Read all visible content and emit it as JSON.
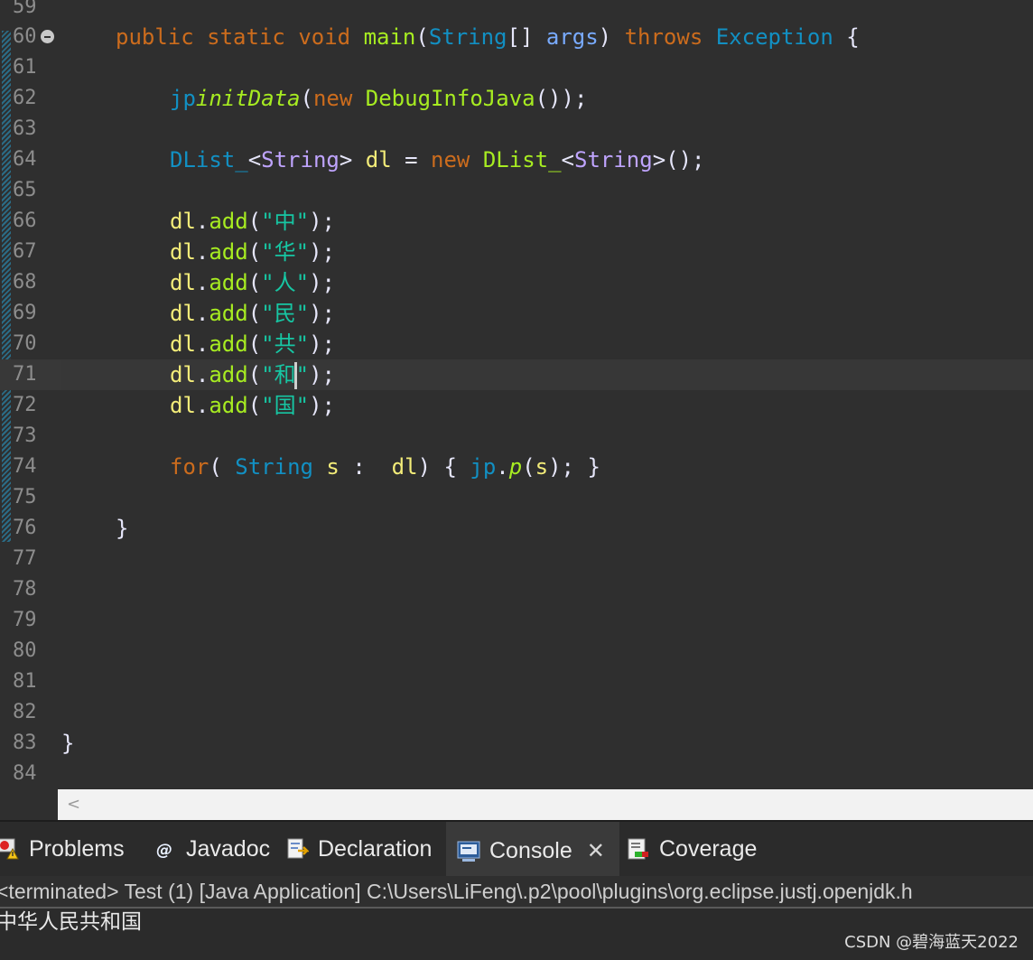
{
  "editor": {
    "lines": [
      {
        "n": "59"
      },
      {
        "n": "60"
      },
      {
        "n": "61"
      },
      {
        "n": "62"
      },
      {
        "n": "63"
      },
      {
        "n": "64"
      },
      {
        "n": "65"
      },
      {
        "n": "66"
      },
      {
        "n": "67"
      },
      {
        "n": "68"
      },
      {
        "n": "69"
      },
      {
        "n": "70"
      },
      {
        "n": "71"
      },
      {
        "n": "72"
      },
      {
        "n": "73"
      },
      {
        "n": "74"
      },
      {
        "n": "75"
      },
      {
        "n": "76"
      },
      {
        "n": "77"
      },
      {
        "n": "78"
      },
      {
        "n": "79"
      },
      {
        "n": "80"
      },
      {
        "n": "81"
      },
      {
        "n": "82"
      },
      {
        "n": "83"
      },
      {
        "n": "84"
      }
    ],
    "code": {
      "l60": {
        "public": "public",
        "static": "static",
        "void": "void",
        "main": "main",
        "p1": "(",
        "String": "String",
        "arr": "[] ",
        "args": "args",
        "p2": ") ",
        "throws": "throws",
        "Exception": "Exception",
        "p3": " {"
      },
      "l62": {
        "jp": "jp",
        ".": ".",
        "initData": "initData",
        "p1": "(",
        "new": "new",
        "DebugInfoJava": "DebugInfoJava",
        "p2": "());"
      },
      "l64": {
        "DList": "DList_",
        "lt": "<",
        "String": "String",
        "gt": "> ",
        "dl": "dl",
        "eq": " = ",
        "new": "new",
        "DList2": "DList_",
        "lt2": "<",
        "String2": "String",
        "gt2": ">",
        "end": "();"
      },
      "adds": [
        {
          "obj": "dl",
          "dot": ".",
          "method": "add",
          "open": "(",
          "str": "\"中\"",
          "close": ");"
        },
        {
          "obj": "dl",
          "dot": ".",
          "method": "add",
          "open": "(",
          "str": "\"华\"",
          "close": ");"
        },
        {
          "obj": "dl",
          "dot": ".",
          "method": "add",
          "open": "(",
          "str": "\"人\"",
          "close": ");"
        },
        {
          "obj": "dl",
          "dot": ".",
          "method": "add",
          "open": "(",
          "str": "\"民\"",
          "close": ");"
        },
        {
          "obj": "dl",
          "dot": ".",
          "method": "add",
          "open": "(",
          "str": "\"共\"",
          "close": ");"
        },
        {
          "obj": "dl",
          "dot": ".",
          "method": "add",
          "open": "(",
          "str_a": "\"和",
          "str_b": "\"",
          "close": ");"
        },
        {
          "obj": "dl",
          "dot": ".",
          "method": "add",
          "open": "(",
          "str": "\"国\"",
          "close": ");"
        }
      ],
      "l74": {
        "for": "for",
        "p1": "( ",
        "String": "String",
        "s": "s",
        "colon": " :  ",
        "dl": "dl",
        "p2": ") { ",
        "jp": "jp",
        "dot": ".",
        "p": "p",
        "p3": "(",
        "s2": "s",
        "p4": "); }"
      },
      "l76": {
        "brace": "}"
      },
      "l83": {
        "brace": "}"
      }
    }
  },
  "scrollbar": {
    "left_arrow": "<"
  },
  "panel": {
    "tabs": [
      {
        "label": "Problems",
        "icon": "problems-icon"
      },
      {
        "label": "Javadoc",
        "icon": "javadoc-icon"
      },
      {
        "label": "Declaration",
        "icon": "declaration-icon"
      },
      {
        "label": "Console",
        "icon": "console-icon",
        "active": true
      },
      {
        "label": "Coverage",
        "icon": "coverage-icon"
      }
    ],
    "close_glyph": "✕",
    "status": "<terminated> Test (1) [Java Application] C:\\Users\\LiFeng\\.p2\\pool\\plugins\\org.eclipse.justj.openjdk.h",
    "output": "中华人民共和国"
  },
  "watermark": "CSDN @碧海蓝天2022",
  "colors": {
    "editor_bg": "#2f2f2f",
    "keyword": "#cc6c1d",
    "method": "#a7ec21",
    "type": "#1290c3",
    "string": "#17c6a3",
    "local": "#f3ec79"
  }
}
